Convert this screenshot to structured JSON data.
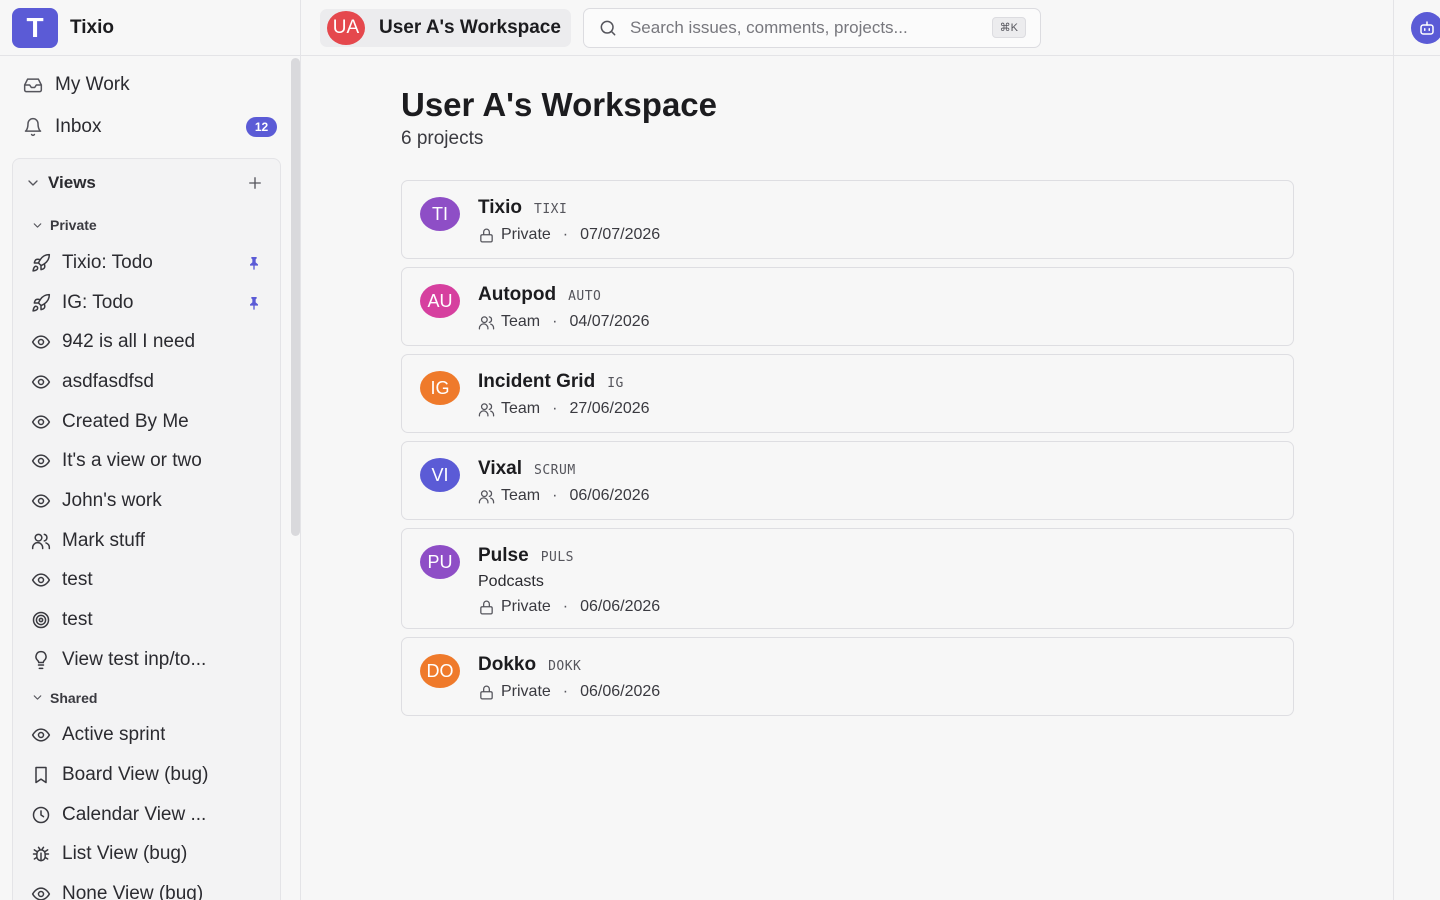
{
  "brand": {
    "logo_letter": "T",
    "name": "Tixio"
  },
  "nav": [
    {
      "label": "My Work",
      "icon": "inbox-tray-icon"
    },
    {
      "label": "Inbox",
      "icon": "bell-icon",
      "badge": "12"
    }
  ],
  "views": {
    "title": "Views",
    "groups": [
      {
        "title": "Private",
        "items": [
          {
            "label": "Tixio: Todo",
            "icon": "rocket-icon",
            "pinned": true
          },
          {
            "label": "IG: Todo",
            "icon": "rocket-icon",
            "pinned": true
          },
          {
            "label": "942 is all I need",
            "icon": "eye-icon"
          },
          {
            "label": "asdfasdfsd",
            "icon": "eye-icon"
          },
          {
            "label": "Created By Me",
            "icon": "eye-icon"
          },
          {
            "label": "It's a view or two",
            "icon": "eye-icon"
          },
          {
            "label": "John's work",
            "icon": "eye-icon"
          },
          {
            "label": "Mark stuff",
            "icon": "users-icon"
          },
          {
            "label": "test",
            "icon": "eye-icon"
          },
          {
            "label": "test",
            "icon": "target-icon"
          },
          {
            "label": "View test inp/to...",
            "icon": "lightbulb-icon"
          }
        ]
      },
      {
        "title": "Shared",
        "items": [
          {
            "label": "Active sprint",
            "icon": "eye-icon"
          },
          {
            "label": "Board View (bug)",
            "icon": "bookmark-icon"
          },
          {
            "label": "Calendar View ...",
            "icon": "clock-icon"
          },
          {
            "label": "List View (bug)",
            "icon": "bug-icon"
          },
          {
            "label": "None View (bug)",
            "icon": "eye-icon"
          }
        ]
      }
    ]
  },
  "topbar": {
    "workspace_initials": "UA",
    "workspace_name": "User A's Workspace",
    "search_placeholder": "Search issues, comments, projects...",
    "search_value": "",
    "shortcut": "⌘K"
  },
  "main": {
    "title": "User A's Workspace",
    "subtitle": "6 projects",
    "projects": [
      {
        "initials": "TI",
        "name": "Tixio",
        "key": "TIXI",
        "visibility": "Private",
        "date": "07/07/2026",
        "color": "#8e4ec6"
      },
      {
        "initials": "AU",
        "name": "Autopod",
        "key": "AUTO",
        "visibility": "Team",
        "date": "04/07/2026",
        "color": "#d6409f"
      },
      {
        "initials": "IG",
        "name": "Incident Grid",
        "key": "IG",
        "visibility": "Team",
        "date": "27/06/2026",
        "color": "#ef7a2b"
      },
      {
        "initials": "VI",
        "name": "Vixal",
        "key": "SCRUM",
        "visibility": "Team",
        "date": "06/06/2026",
        "color": "#5b5bd6"
      },
      {
        "initials": "PU",
        "name": "Pulse",
        "key": "PULS",
        "description": "Podcasts",
        "visibility": "Private",
        "date": "06/06/2026",
        "color": "#8e4ec6"
      },
      {
        "initials": "DO",
        "name": "Dokko",
        "key": "DOKK",
        "visibility": "Private",
        "date": "06/06/2026",
        "color": "#ef7a2b"
      }
    ]
  },
  "colors": {
    "accent": "#5b5bd6",
    "workspace_avatar": "#e5484d"
  }
}
